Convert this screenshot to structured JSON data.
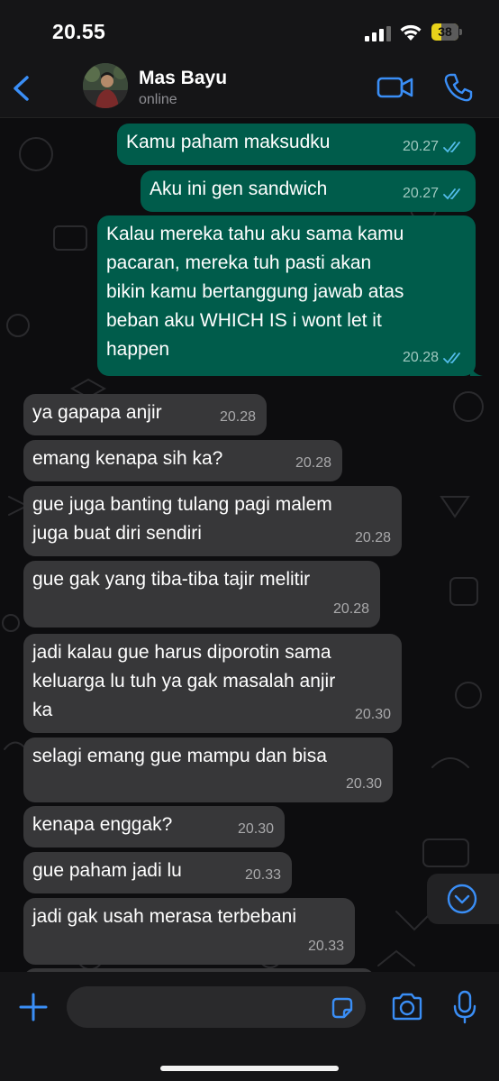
{
  "status_bar": {
    "time": "20.55",
    "battery_level": "38",
    "battery_fraction": 0.38
  },
  "header": {
    "contact_name": "Mas Bayu",
    "contact_status": "online"
  },
  "colors": {
    "accent": "#3a8ef6",
    "outgoing_bubble": "#005c4b",
    "incoming_bubble": "#373739",
    "read_ticks": "#53bdeb",
    "battery": "#e8d21a"
  },
  "messages": [
    {
      "direction": "out",
      "text": "Kamu paham maksudku",
      "time": "20.27",
      "status": "read"
    },
    {
      "direction": "out",
      "text": "Aku ini gen sandwich",
      "time": "20.27",
      "status": "read"
    },
    {
      "direction": "out",
      "text": "Kalau mereka tahu aku sama kamu\npacaran, mereka tuh pasti akan\nbikin kamu bertanggung jawab atas\nbeban aku WHICH IS i wont let it\nhappen",
      "time": "20.28",
      "status": "read"
    },
    {
      "direction": "in",
      "text": "ya gapapa anjir",
      "time": "20.28"
    },
    {
      "direction": "in",
      "text": "emang kenapa sih ka?",
      "time": "20.28"
    },
    {
      "direction": "in",
      "text": "gue juga banting tulang pagi malem\njuga buat diri sendiri",
      "time": "20.28"
    },
    {
      "direction": "in",
      "text": "gue gak yang tiba-tiba tajir melitir",
      "time": "20.28"
    },
    {
      "direction": "in",
      "text": "jadi kalau gue harus diporotin sama\nkeluarga lu tuh ya gak masalah anjir\nka",
      "time": "20.30"
    },
    {
      "direction": "in",
      "text": "selagi emang gue mampu dan bisa",
      "time": "20.30"
    },
    {
      "direction": "in",
      "text": "kenapa enggak?",
      "time": "20.30"
    },
    {
      "direction": "in",
      "text": "gue paham jadi lu",
      "time": "20.33"
    },
    {
      "direction": "in",
      "text": "jadi gak usah merasa terbebani",
      "time": "20.33"
    },
    {
      "direction": "in",
      "text": "",
      "time": ""
    }
  ],
  "composer": {
    "text": ""
  },
  "icons": {
    "back": "chevron-left-icon",
    "video": "video-camera-icon",
    "call": "phone-icon",
    "scroll": "chevron-down-circle-icon",
    "plus": "plus-icon",
    "sticker": "sticker-icon",
    "camera": "camera-icon",
    "mic": "microphone-icon"
  }
}
